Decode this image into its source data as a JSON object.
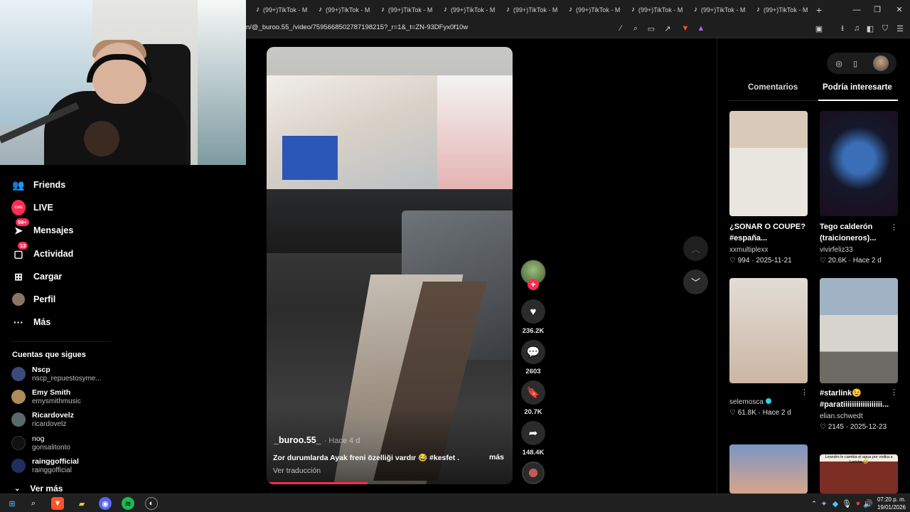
{
  "browser": {
    "tab_label": "(99+)TikTok - M",
    "tab_count": 9,
    "new_tab": "+",
    "url": "n/@_buroo.55_/video/7595668502787198215?_r=1&_t=ZN-93DFyx0f10w",
    "window_controls": [
      "minimize",
      "restore",
      "close"
    ]
  },
  "sidebar": {
    "items": [
      {
        "label": "Friends",
        "icon": "friends-icon"
      },
      {
        "label": "LIVE",
        "icon": "live-icon",
        "icon_text": "LIVE"
      },
      {
        "label": "Mensajes",
        "icon": "messages-icon",
        "badge": "99+"
      },
      {
        "label": "Actividad",
        "icon": "activity-icon",
        "badge": "13"
      },
      {
        "label": "Cargar",
        "icon": "upload-icon"
      },
      {
        "label": "Perfil",
        "icon": "profile-icon"
      },
      {
        "label": "Más",
        "icon": "more-icon"
      }
    ],
    "following_title": "Cuentas que sigues",
    "following": [
      {
        "name": "Nscp",
        "username": "nscp_repuestosyme...",
        "color": "#3b4a7a"
      },
      {
        "name": "Emy Smith",
        "username": "emysmithmusic",
        "color": "#b08a5a"
      },
      {
        "name": "Ricardovelz",
        "username": "ricardovelz",
        "color": "#5a6a6a"
      },
      {
        "name": "nog",
        "username": "gonsalitonto",
        "color": "#111111"
      },
      {
        "name": "rainggofficial",
        "username": "rainggofficial",
        "color": "#1f2f5f"
      }
    ],
    "see_more": "Ver más"
  },
  "video": {
    "author": "_buroo.55_",
    "time": "· Hace 4 d",
    "caption": "Zor durumlarda Ayak freni özelliği vardır 😂 #kesfet ...",
    "more": "más",
    "translate": "Ver traducción",
    "progress": 0.41
  },
  "actions": {
    "likes": "236.2K",
    "comments": "2603",
    "saves": "20.7K",
    "shares": "148.4K"
  },
  "right_panel": {
    "tabs": [
      "Comentarios",
      "Podría interesarte"
    ],
    "active_tab": 1,
    "cards": [
      {
        "title": "¿SONAR O COUPE?#españa...",
        "user": "xxmultiplexx",
        "likes": "994",
        "date": "2025-11-21"
      },
      {
        "title": "Tego calderón (traicioneros)...",
        "user": "vivirfeliz33",
        "likes": "20.6K",
        "date": "Hace 2 d"
      },
      {
        "title": "",
        "user": "selemosca",
        "likes": "61.8K",
        "date": "Hace 2 d"
      },
      {
        "title": "#starlink😉 #paratiiiiiiiiiiiiiiiiii...",
        "user": "elian.schwedt",
        "likes": "2145",
        "date": "2025-12-23"
      },
      {
        "title": "",
        "user": "",
        "likes": "",
        "date": ""
      },
      {
        "title": "",
        "user": "",
        "likes": "",
        "date": "",
        "overlay": "Leandro le cambia el agua por vodka a Loriche 😂"
      }
    ]
  },
  "taskbar": {
    "time": "07:20 p. m.",
    "date": "19/01/2026"
  },
  "colors": {
    "accent": "#fe2c55",
    "background": "#000000",
    "verified": "#20d5ec"
  }
}
